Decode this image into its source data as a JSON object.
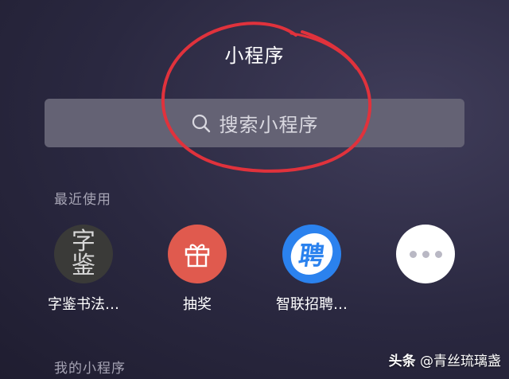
{
  "header": {
    "title": "小程序"
  },
  "search": {
    "placeholder": "搜索小程序",
    "icon": "search-icon"
  },
  "annotation": {
    "color": "#e0323c"
  },
  "recent": {
    "label": "最近使用",
    "apps": [
      {
        "name": "字鉴书法…",
        "glyphs": [
          "字",
          "鉴"
        ]
      },
      {
        "name": "抽奖",
        "icon": "gift-icon",
        "color": "#e05a4e"
      },
      {
        "name": "智联招聘…",
        "glyph": "聘",
        "color": "#2b82ee"
      },
      {
        "name": "",
        "icon": "more-icon"
      }
    ]
  },
  "my_programs": {
    "label": "我的小程序"
  },
  "watermark": {
    "brand": "头条",
    "handle": "@青丝琉璃盏"
  }
}
